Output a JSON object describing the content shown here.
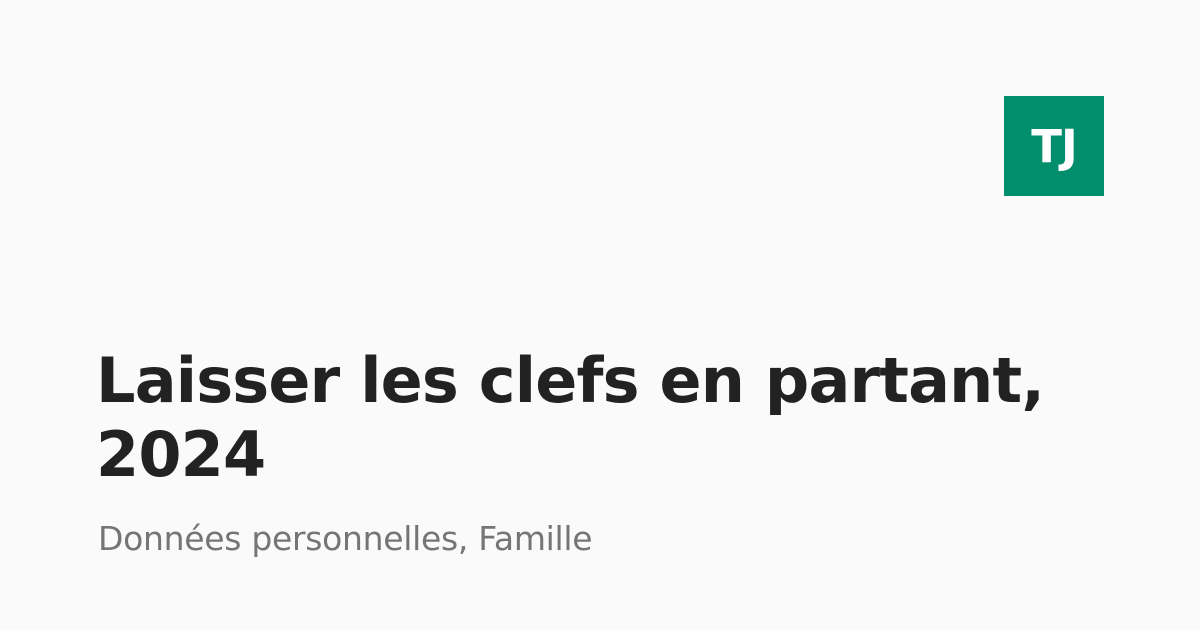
{
  "logo": {
    "text": "TJ",
    "background_color": "#008e6d",
    "text_color": "#ffffff"
  },
  "title": "Laisser les clefs en partant, 2024",
  "subtitle": "Données personnelles, Famille",
  "colors": {
    "background": "#fafafa",
    "title": "#222222",
    "subtitle": "#757575"
  }
}
